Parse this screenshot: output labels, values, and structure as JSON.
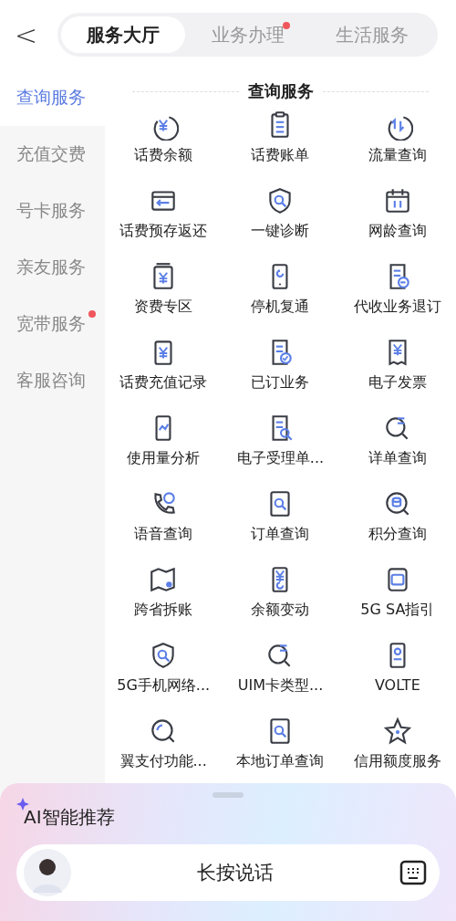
{
  "back_button": {
    "label": "<"
  },
  "tabs": [
    {
      "label": "服务大厅",
      "selected": true,
      "dot": false
    },
    {
      "label": "业务办理",
      "selected": false,
      "dot": true
    },
    {
      "label": "生活服务",
      "selected": false,
      "dot": false
    }
  ],
  "sidebar": {
    "items": [
      {
        "label": "查询服务",
        "selected": true,
        "dot": false
      },
      {
        "label": "充值交费",
        "selected": false,
        "dot": false
      },
      {
        "label": "号卡服务",
        "selected": false,
        "dot": false
      },
      {
        "label": "亲友服务",
        "selected": false,
        "dot": false
      },
      {
        "label": "宽带服务",
        "selected": false,
        "dot": true
      },
      {
        "label": "客服咨询",
        "selected": false,
        "dot": false
      }
    ]
  },
  "section": {
    "title": "查询服务",
    "items": [
      {
        "label": "话费余额"
      },
      {
        "label": "话费账单"
      },
      {
        "label": "流量查询"
      },
      {
        "label": "话费预存返还"
      },
      {
        "label": "一键诊断"
      },
      {
        "label": "网龄查询"
      },
      {
        "label": "资费专区"
      },
      {
        "label": "停机复通"
      },
      {
        "label": "代收业务退订"
      },
      {
        "label": "话费充值记录"
      },
      {
        "label": "已订业务"
      },
      {
        "label": "电子发票"
      },
      {
        "label": "使用量分析"
      },
      {
        "label": "电子受理单..."
      },
      {
        "label": "详单查询"
      },
      {
        "label": "语音查询"
      },
      {
        "label": "订单查询"
      },
      {
        "label": "积分查询"
      },
      {
        "label": "跨省拆账"
      },
      {
        "label": "余额变动"
      },
      {
        "label": "5G SA指引"
      },
      {
        "label": "5G手机网络..."
      },
      {
        "label": "UIM卡类型..."
      },
      {
        "label": "VOLTE"
      },
      {
        "label": "翼支付功能..."
      },
      {
        "label": "本地订单查询"
      },
      {
        "label": "信用额度服务"
      }
    ]
  },
  "assistant": {
    "title": "AI智能推荐",
    "voice_button": "长按说话"
  }
}
